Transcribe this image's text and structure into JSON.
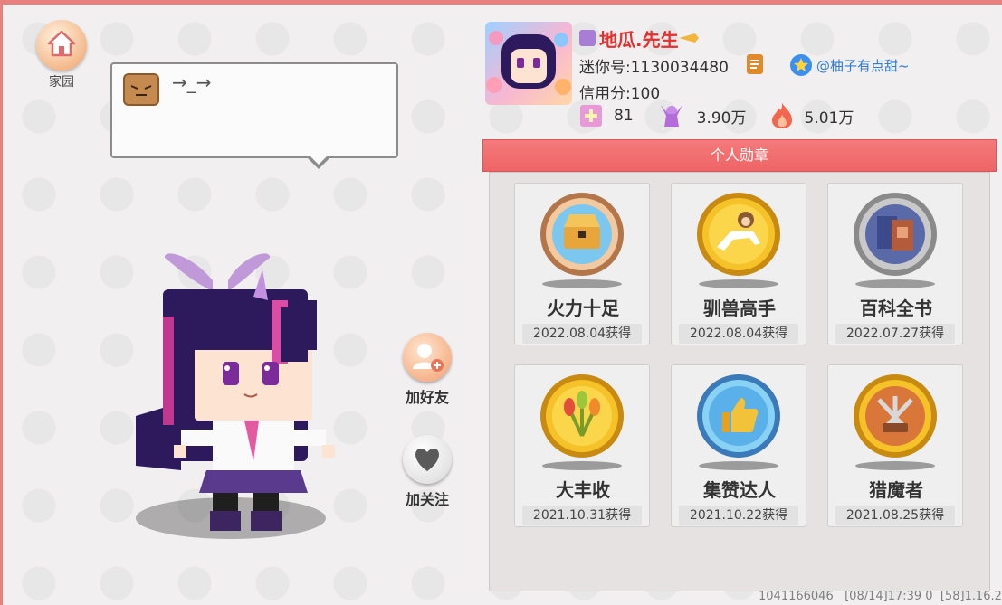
{
  "home": {
    "label": "家园",
    "icon": "house-icon"
  },
  "bubble": {
    "text": "→_→",
    "icon": "face-emote-icon"
  },
  "side_buttons": {
    "add_friend": {
      "label": "加好友",
      "icon": "add-user-icon"
    },
    "follow": {
      "label": "加关注",
      "icon": "heart-icon"
    }
  },
  "profile": {
    "name": "地瓜.先生",
    "id_text": "迷你号:1130034480",
    "friend_tag": "@柚子有点甜~",
    "credit_text": "信用分:100",
    "stats": [
      {
        "icon": "plus-badge-icon",
        "value": "81"
      },
      {
        "icon": "cheer-icon",
        "value": "3.90万"
      },
      {
        "icon": "flame-icon",
        "value": "5.01万"
      }
    ]
  },
  "medals": {
    "title": "个人勋章",
    "items": [
      {
        "name": "火力十足",
        "date": "2022.08.04获得",
        "icon": "treasure-chest-medal-icon"
      },
      {
        "name": "驯兽高手",
        "date": "2022.08.04获得",
        "icon": "monkey-rider-medal-icon"
      },
      {
        "name": "百科全书",
        "date": "2022.07.27获得",
        "icon": "books-medal-icon"
      },
      {
        "name": "大丰收",
        "date": "2021.10.31获得",
        "icon": "harvest-medal-icon"
      },
      {
        "name": "集赞达人",
        "date": "2021.10.22获得",
        "icon": "thumbs-up-medal-icon"
      },
      {
        "name": "猎魔者",
        "date": "2021.08.25获得",
        "icon": "swords-medal-icon"
      }
    ]
  },
  "footer": "1041166046   [08/14]17:39 0  [58]1.16.2",
  "colors": {
    "accent": "#ee6466",
    "name": "#e3312f",
    "link": "#2f7bd8"
  }
}
